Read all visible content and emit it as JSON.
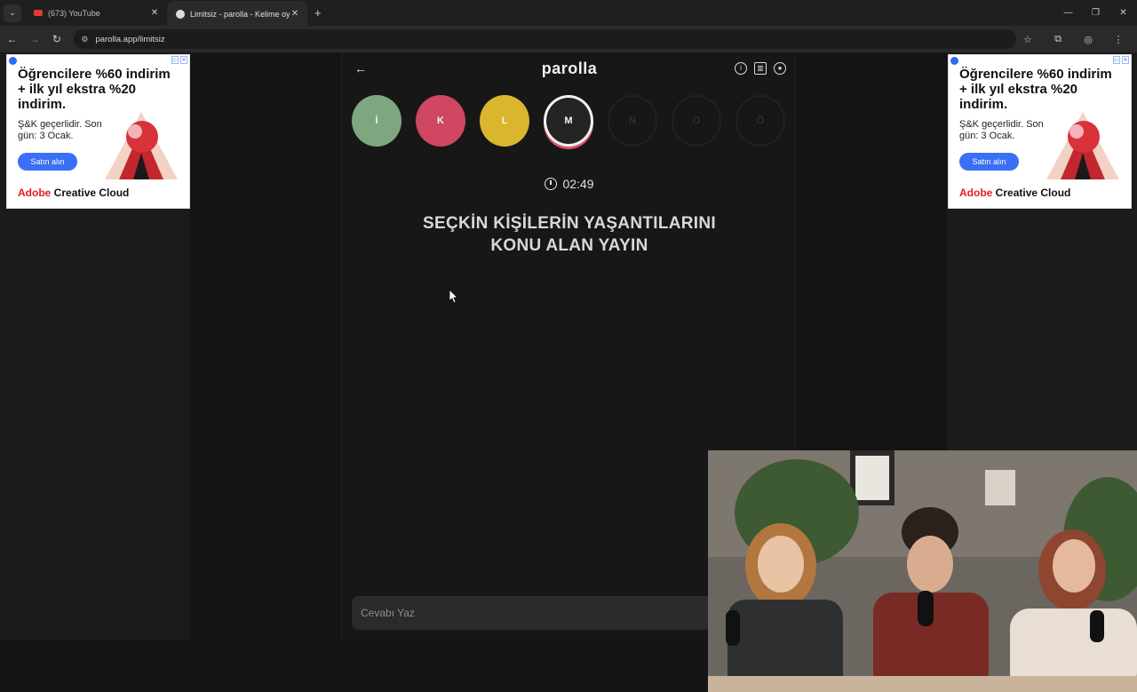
{
  "browser": {
    "tabs": [
      {
        "title": "(673) YouTube",
        "active": false
      },
      {
        "title": "Limitsiz - parolla - Kelime oyunu",
        "active": true
      }
    ],
    "url": "parolla.app/limitsiz"
  },
  "ads": {
    "headline": "Öğrencilere %60 indirim + ilk yıl ekstra %20 indirim.",
    "sub": "Ş&K geçerlidir. Son gün: 3 Ocak.",
    "cta": "Satın alın",
    "brand_red": "Adobe",
    "brand_rest": " Creative Cloud"
  },
  "game": {
    "title": "parolla",
    "letters": [
      {
        "letter": "İ",
        "state": "correct",
        "color": "#7fa77f"
      },
      {
        "letter": "K",
        "state": "wrong",
        "color": "#cf4760"
      },
      {
        "letter": "L",
        "state": "pass",
        "color": "#d9b62e"
      },
      {
        "letter": "M",
        "state": "current",
        "color": "#242424"
      },
      {
        "letter": "N",
        "state": "empty"
      },
      {
        "letter": "O",
        "state": "empty"
      },
      {
        "letter": "Ö",
        "state": "empty"
      }
    ],
    "timer": "02:49",
    "question": "SEÇKİN KİŞİLERİN YAŞANTILARINI KONU ALAN YAYIN",
    "answer_placeholder": "Cevabı Yaz"
  },
  "icons": [
    "back-arrow-icon",
    "info-icon",
    "stats-icon",
    "profile-icon",
    "clock-icon",
    "star-icon",
    "extensions-icon",
    "account-icon",
    "menu-icon"
  ]
}
